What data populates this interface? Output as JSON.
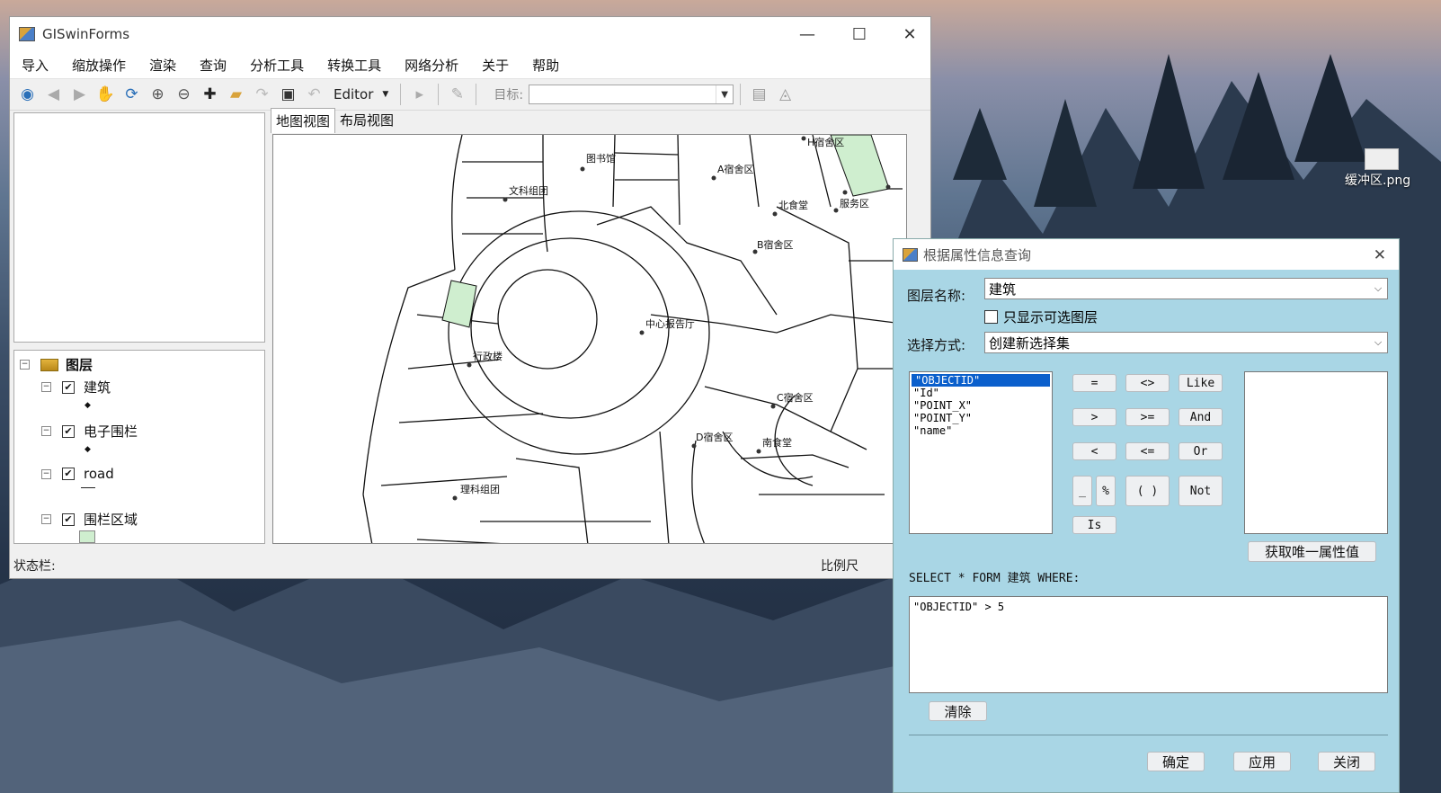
{
  "desktop": {
    "file_label": "缓冲区.png"
  },
  "main_window": {
    "title": "GISwinForms",
    "menu": [
      "导入",
      "缩放操作",
      "渲染",
      "查询",
      "分析工具",
      "转换工具",
      "网络分析",
      "关于",
      "帮助"
    ],
    "toolbar": {
      "editor_label": "Editor",
      "target_label": "目标:",
      "target_value": ""
    },
    "tabs": [
      "地图视图",
      "布局视图"
    ],
    "toc": {
      "root": "图层",
      "layers": [
        {
          "name": "建筑",
          "checked": true
        },
        {
          "name": "电子围栏",
          "checked": true
        },
        {
          "name": "road",
          "checked": true
        },
        {
          "name": "围栏区域",
          "checked": true
        }
      ]
    },
    "status": {
      "left": "状态栏:",
      "right": "比例尺"
    },
    "map_labels": [
      "图书馆",
      "文科组团",
      "A宿舍区",
      "H宿舍区",
      "北食堂",
      "服务区",
      "B宿舍区",
      "中心报告厅",
      "行政楼",
      "C宿舍区",
      "D宿舍区",
      "南食堂",
      "理科组团"
    ]
  },
  "dialog": {
    "title": "根据属性信息查询",
    "layer_label": "图层名称:",
    "layer_value": "建筑",
    "only_selectable_label": "只显示可选图层",
    "only_selectable_checked": false,
    "method_label": "选择方式:",
    "method_value": "创建新选择集",
    "fields": [
      "\"OBJECTID\"",
      "\"Id\"",
      "\"POINT_X\"",
      "\"POINT_Y\"",
      "\"name\""
    ],
    "selected_field_index": 0,
    "operators": [
      "=",
      "<>",
      "Like",
      ">",
      ">=",
      "And",
      "<",
      "<=",
      "Or",
      "_",
      "%",
      "( )",
      "Not",
      "Is"
    ],
    "unique_values_button": "获取唯一属性值",
    "sql_prefix": "SELECT * FORM  建筑  WHERE:",
    "sql_text": "\"OBJECTID\" > 5",
    "clear_button": "清除",
    "ok_button": "确定",
    "apply_button": "应用",
    "close_button": "关闭"
  },
  "colors": {
    "dialog_bg": "#a9d6e5",
    "selection": "#0a5fcc",
    "polygon_fill": "#cfeecf"
  }
}
